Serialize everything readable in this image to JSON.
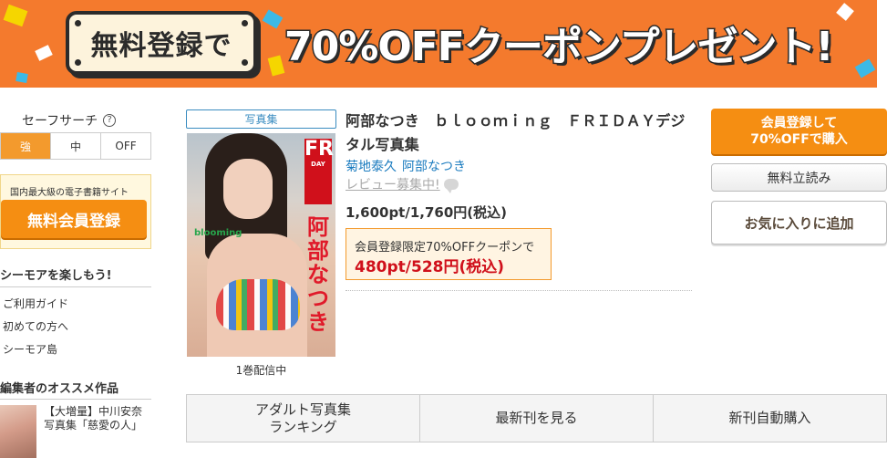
{
  "banner": {
    "badge": "無料登録で",
    "headline": "70%OFFクーポンプレゼント!"
  },
  "sidebar": {
    "safe_search": {
      "label": "セーフサーチ",
      "help_icon": "?",
      "options": [
        "強",
        "中",
        "OFF"
      ],
      "selected": "強"
    },
    "register_box": {
      "caption": "国内最大級の電子書籍サイト",
      "button": "無料会員登録"
    },
    "enjoy_heading": "シーモアを楽しもう!",
    "links": [
      "ご利用ガイド",
      "初めての方へ",
      "シーモア島"
    ],
    "recommend_heading": "編集者のオススメ作品",
    "recommend_item": "【大増量】中川安奈写真集「慈愛の人」"
  },
  "product": {
    "category_tag": "写真集",
    "title": "阿部なつき　ｂｌｏｏｍｉｎｇ　ＦＲＩＤＡＹデジタル写真集",
    "authors": [
      "菊地泰久",
      "阿部なつき"
    ],
    "review_link": "レビュー募集中!",
    "price": "1,600pt/1,760円(税込)",
    "coupon_caption": "会員登録限定70%OFFクーポンで",
    "coupon_price": "480pt/528円(税込)",
    "volume_info": "1巻配信中",
    "cover": {
      "magazine_logo": "FRI",
      "magazine_sub": "DAY",
      "vertical_name": "阿部なつき",
      "series": "blooming"
    }
  },
  "actions": {
    "primary_line1": "会員登録して",
    "primary_line2": "70%OFFで購入",
    "free_read": "無料立読み",
    "favorite": "お気に入りに追加"
  },
  "tabs": [
    {
      "line1": "アダルト写真集",
      "line2": "ランキング"
    },
    {
      "line1": "最新刊を見る",
      "line2": ""
    },
    {
      "line1": "新刊自動購入",
      "line2": ""
    }
  ],
  "colors": {
    "banner_bg": "#f47a2d",
    "accent_orange": "#f58e12",
    "link_blue": "#1a7bbf",
    "price_red": "#d0101b"
  }
}
